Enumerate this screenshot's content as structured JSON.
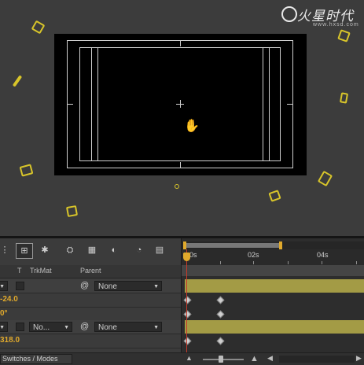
{
  "logo": {
    "brand": "火星时代",
    "url": "www.hxsd.com"
  },
  "toolbar": {
    "tools": [
      {
        "name": "shy-layers-icon",
        "glyph": "⊞"
      },
      {
        "name": "draft-3d-icon",
        "glyph": "✱"
      },
      {
        "name": "hide-shy-icon",
        "glyph": "⛭"
      },
      {
        "name": "frame-blending-icon",
        "glyph": "▦"
      },
      {
        "name": "motion-blur-icon",
        "glyph": "◐"
      },
      {
        "name": "graph-editor-icon",
        "glyph": "◔"
      },
      {
        "name": "brainstorm-icon",
        "glyph": "▤"
      }
    ]
  },
  "columns": {
    "t": "T",
    "trkmat": "TrkMat",
    "parent": "Parent"
  },
  "layers": [
    {
      "trkmat": "",
      "parent": "None",
      "prop": "-24.0"
    },
    {
      "trkmat": "",
      "parent": "",
      "prop": "0°"
    },
    {
      "trkmat": "No...",
      "parent": "None",
      "prop": ""
    },
    {
      "trkmat": "",
      "parent": "",
      "prop": "318.0"
    }
  ],
  "ruler": {
    "labels": [
      "0s",
      "02s",
      "04s"
    ]
  },
  "status": {
    "switches_label": "Switches / Modes"
  },
  "colors": {
    "accent": "#e0a92c",
    "layer_bar": "#a39b45",
    "playhead": "#c53a2a",
    "shape_stroke": "#d8c52a"
  }
}
